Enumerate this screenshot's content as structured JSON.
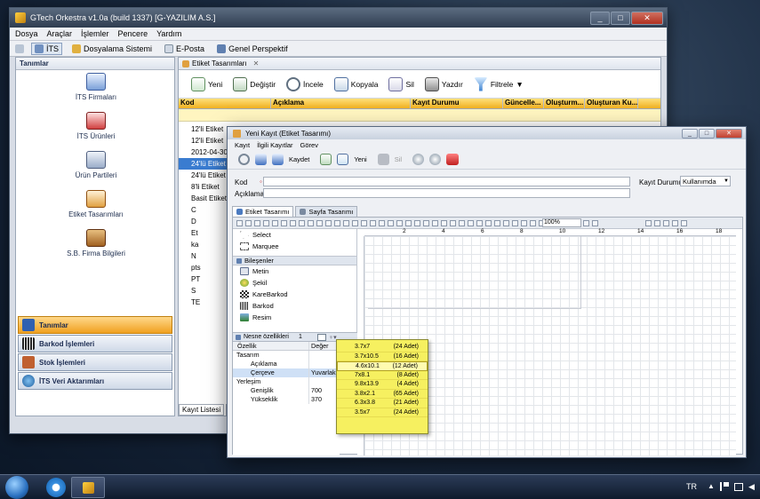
{
  "main_window": {
    "title": "GTech Orkestra v1.0a (build 1337) [G-YAZILIM A.S.]",
    "menu": [
      "Dosya",
      "Araçlar",
      "İşlemler",
      "Pencere",
      "Yardım"
    ],
    "perspectives": [
      "İTS",
      "Dosyalama Sistemi",
      "E-Posta",
      "Genel Perspektif"
    ]
  },
  "left_panel": {
    "header": "Tanımlar",
    "items": [
      "İTS Firmaları",
      "İTS Ürünleri",
      "Ürün Partileri",
      "Etiket Tasarımları",
      "S.B. Firma Bilgileri"
    ],
    "categories": [
      "Tanımlar",
      "Barkod İşlemleri",
      "Stok İşlemleri",
      "İTS Veri Aktarımları"
    ]
  },
  "editor": {
    "tab_label": "Etiket Tasarımları",
    "toolbar": [
      "Yeni",
      "Değiştir",
      "İncele",
      "Kopyala",
      "Sil",
      "Yazdır",
      "Filtrele"
    ],
    "columns": [
      "Kod",
      "Açıklama",
      "Kayıt Durumu",
      "Güncelle...",
      "Oluşturm...",
      "Oluşturan Ku..."
    ],
    "rows": [
      "12'li Etiket",
      "12'li Etiket",
      "2012-04-30",
      "24'lü Etiket",
      "24'lü Etiket",
      "8'li Etiket",
      "Basit Etiket",
      "C",
      "D",
      "Et",
      "ka",
      "N",
      "pts",
      "PT",
      "S",
      "TE"
    ],
    "selected_row_index": 3,
    "bottom_tabs": [
      "Kayıt Listesi",
      "Fi"
    ]
  },
  "dialog": {
    "title": "Yeni Kayıt (Etiket Tasarımı)",
    "menu": [
      "Kayıt",
      "İlgili Kayıtlar",
      "Görev"
    ],
    "toolbar": [
      "Kaydet",
      "Yeni",
      "Sil"
    ],
    "fields": {
      "kod_label": "Kod",
      "aciklama_label": "Açıklama",
      "durum_label": "Kayıt Durumu",
      "durum_value": "Kullanımda"
    },
    "tabs": [
      "Etiket Tasarımı",
      "Sayfa Tasarımı"
    ],
    "zoom": "100%",
    "ruler": [
      "2",
      "4",
      "6",
      "8",
      "10",
      "12",
      "14",
      "16",
      "18"
    ],
    "tools": [
      "Select",
      "Marquee"
    ],
    "palette_header": "Bileşenler",
    "palette": [
      "Metin",
      "Şekil",
      "KareBarkod",
      "Barkod",
      "Resim"
    ],
    "props_tab": "Nesne özellikleri",
    "props_tab_count": "1",
    "props_columns": [
      "Özellik",
      "Değer"
    ],
    "props": [
      {
        "k": "Tasarım",
        "v": ""
      },
      {
        "k": "Açıklama",
        "v": ""
      },
      {
        "k": "Çerçeve",
        "v": "Yuvarlak"
      },
      {
        "k": "Yerleşim",
        "v": ""
      },
      {
        "k": "Genişlik",
        "v": "700"
      },
      {
        "k": "Yükseklik",
        "v": "370"
      }
    ],
    "popup": [
      {
        "size": "3.7x7",
        "count": "(24 Adet)"
      },
      {
        "size": "3.7x10.5",
        "count": "(16 Adet)"
      },
      {
        "size": "4.6x10.1",
        "count": "(12 Adet)"
      },
      {
        "size": "7x8.1",
        "count": "(8 Adet)"
      },
      {
        "size": "9.8x13.9",
        "count": "(4 Adet)"
      },
      {
        "size": "3.8x2.1",
        "count": "(65 Adet)"
      },
      {
        "size": "6.3x3.8",
        "count": "(21 Adet)"
      },
      {
        "size": "3.5x7",
        "count": "(24 Adet)"
      }
    ]
  },
  "taskbar": {
    "lang": "TR"
  }
}
